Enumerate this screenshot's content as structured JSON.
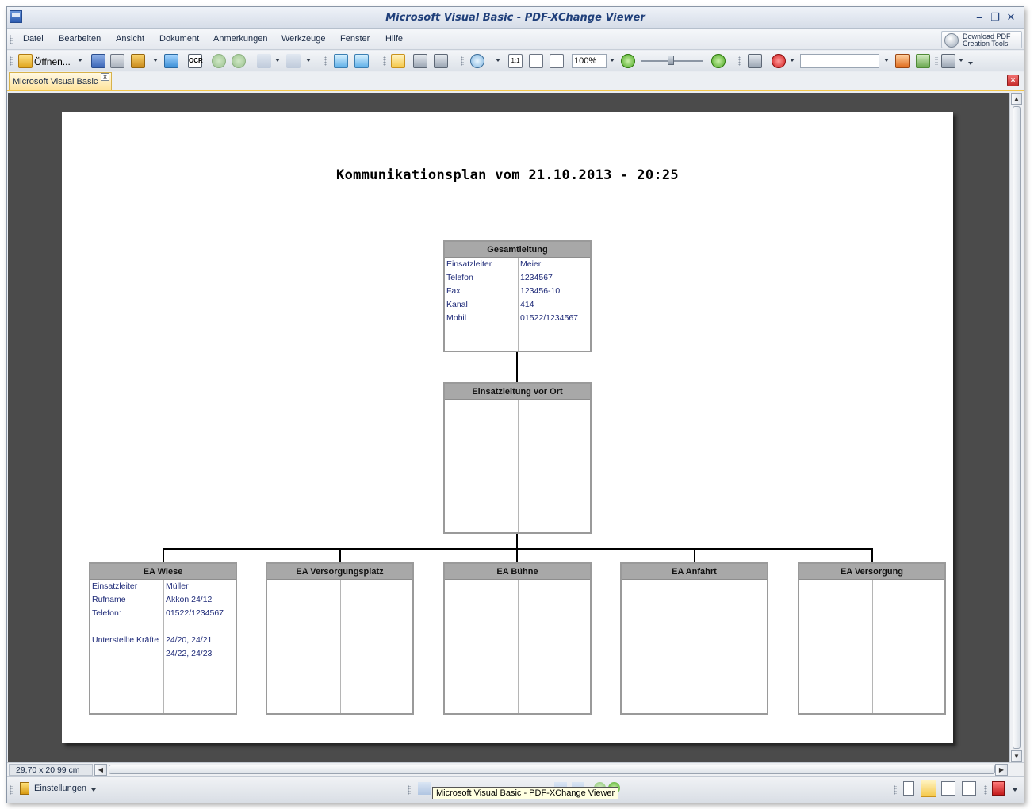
{
  "window": {
    "title": "Microsoft Visual Basic - PDF-XChange Viewer",
    "controls": {
      "minimize": "–",
      "restore": "❐",
      "close": "✕"
    }
  },
  "menu": {
    "items": [
      "Datei",
      "Bearbeiten",
      "Ansicht",
      "Dokument",
      "Anmerkungen",
      "Werkzeuge",
      "Fenster",
      "Hilfe"
    ],
    "download_button": "Download PDF Creation Tools"
  },
  "toolbar": {
    "open_label": "Öffnen...",
    "zoom_value": "100%",
    "search_placeholder": ""
  },
  "tabs": {
    "doc_tab_label": "Microsoft Visual Basic",
    "tab_close_glyph": "×",
    "doc_close_glyph": "×"
  },
  "document": {
    "title": "Kommunikationsplan vom 21.10.2013 - 20:25",
    "gesamtleitung": {
      "header": "Gesamtleitung",
      "rows": [
        {
          "label": "Einsatzleiter",
          "value": "Meier"
        },
        {
          "label": "Telefon",
          "value": "1234567"
        },
        {
          "label": "Fax",
          "value": "123456-10"
        },
        {
          "label": "Kanal",
          "value": "414"
        },
        {
          "label": "Mobil",
          "value": "01522/1234567"
        }
      ]
    },
    "einsatzleitung": {
      "header": "Einsatzleitung vor Ort"
    },
    "abschnitte": [
      {
        "header": "EA Wiese",
        "rows": [
          {
            "label": "Einsatzleiter",
            "value": "Müller"
          },
          {
            "label": "Rufname",
            "value": "Akkon 24/12"
          },
          {
            "label": "Telefon:",
            "value": "01522/1234567"
          },
          {
            "label": "",
            "value": ""
          },
          {
            "label": "Unterstellte Kräfte",
            "value": "24/20, 24/21"
          },
          {
            "label": "",
            "value": "24/22, 24/23"
          }
        ]
      },
      {
        "header": "EA Versorgungsplatz",
        "rows": []
      },
      {
        "header": "EA Bühne",
        "rows": []
      },
      {
        "header": "EA Anfahrt",
        "rows": []
      },
      {
        "header": "EA Versorgung",
        "rows": []
      }
    ]
  },
  "statusbar": {
    "page_size": "29,70 x 20,99 cm",
    "settings_label": "Einstellungen",
    "tooltip": "Microsoft Visual Basic - PDF-XChange Viewer"
  },
  "colors": {
    "box_header": "#a8a8a8",
    "box_text": "#1e2a78",
    "tab_accent": "#f2c54a"
  }
}
